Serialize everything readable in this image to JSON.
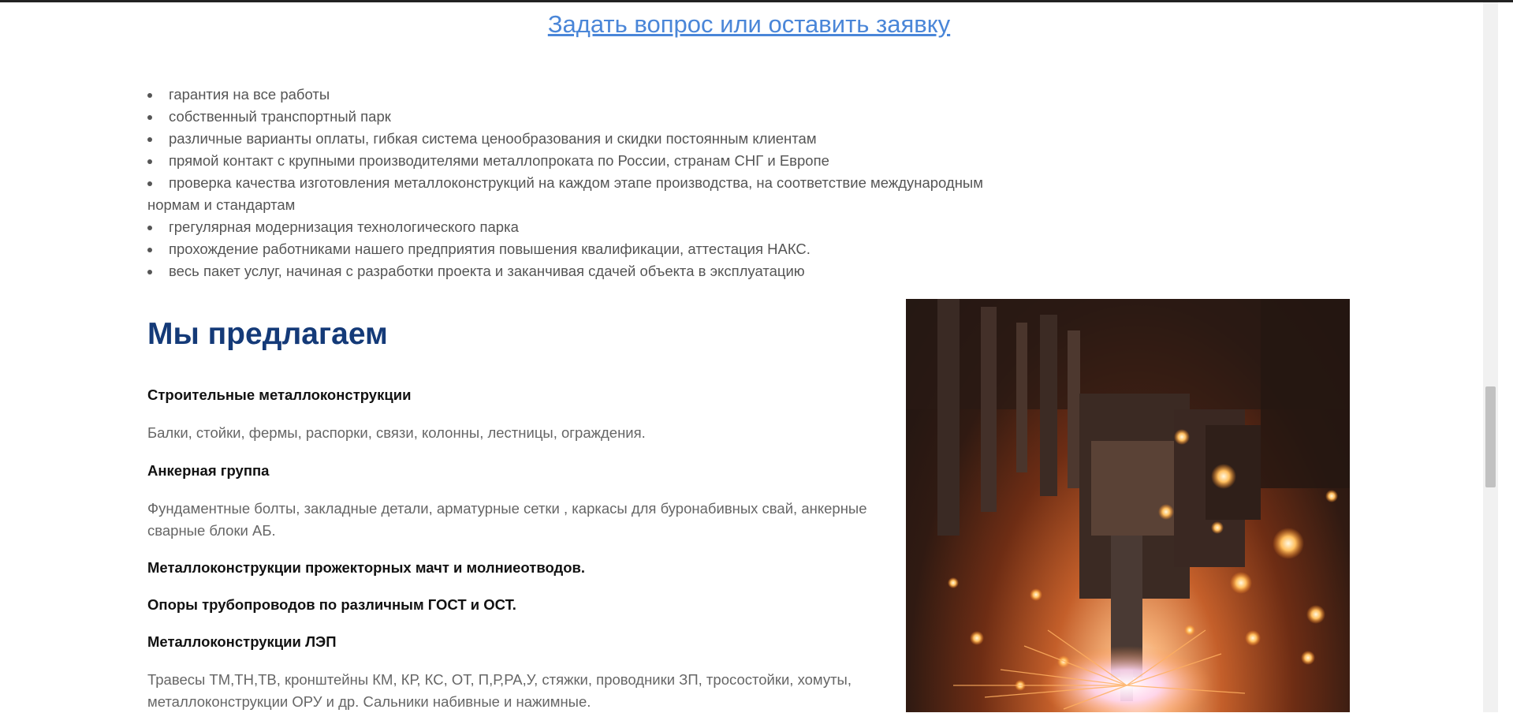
{
  "cta": {
    "link_text": "Задать вопрос или оставить заявку"
  },
  "advantages": {
    "items": [
      "гарантия на все работы",
      "собственный транспортный парк",
      "различные варианты оплаты, гибкая система ценообразования и скидки постоянным клиентам",
      "прямой контакт с крупными производителями металлопроката по России, странам СНГ и Европе",
      "проверка качества изготовления металлоконструкций на каждом этапе производства, на соответствие международным",
      "нормам и стандартам",
      "грегулярная модернизация технологического парка",
      "прохождение работниками нашего предприятия повышения квалификации, аттестация НАКС.",
      "весь пакет услуг, начиная с разработки проекта и заканчивая сдачей объекта в эксплуатацию"
    ]
  },
  "offer": {
    "title": "Мы предлагаем",
    "sections": {
      "s1_title": "Строительные металлоконструкции",
      "s1_text": "Балки, стойки, фермы, распорки, связи, колонны, лестницы, ограждения.",
      "s2_title": "Анкерная группа",
      "s2_text": "Фундаментные болты, закладные детали, арматурные сетки , каркасы для буронабивных свай, анкерные сварные блоки АБ.",
      "s3_title": "Металлоконструкции прожекторных мачт и молниеотводов.",
      "s4_title": "Опоры трубопроводов по различным ГОСТ и ОСТ.",
      "s5_title": "Металлоконструкции ЛЭП",
      "s5_text": "Травесы ТМ,ТН,ТВ, кронштейны КМ, КР, КС, ОТ, П,Р,РА,У, стяжки, проводники ЗП, тросостойки, хомуты, металлоконструкции ОРУ и др. Сальники набивные и нажимные."
    }
  },
  "colors": {
    "link": "#4a86d8",
    "heading": "#143a78",
    "body_text": "#555555"
  },
  "image": {
    "subject": "metal-cutting-sparks-photo"
  }
}
